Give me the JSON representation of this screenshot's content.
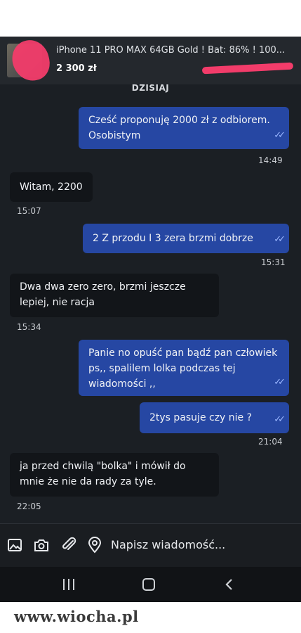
{
  "listing": {
    "title": "iPhone 11 PRO MAX 64GB Gold ! Bat: 86% ! 100...",
    "price": "2 300 zł"
  },
  "chat": {
    "date_separator": "DZISIAJ",
    "messages": [
      {
        "direction": "out",
        "text": "Cześć proponuję 2000 zł z odbiorem. Osobistym",
        "time": "14:49",
        "read": true
      },
      {
        "direction": "in",
        "text": "Witam, 2200",
        "time": "15:07"
      },
      {
        "direction": "out",
        "text": "2 Z przodu I 3 zera brzmi dobrze",
        "time": "15:31",
        "read": true
      },
      {
        "direction": "in",
        "text": "Dwa dwa zero zero, brzmi jeszcze lepiej, nie racja",
        "time": "15:34"
      },
      {
        "direction": "out",
        "text": "Panie no opuść pan bądź pan człowiek  ps,, spalilem  lolka podczas tej  wiadomości  ,,",
        "read": true
      },
      {
        "direction": "out",
        "text": "2tys pasuje  czy nie ?",
        "time": "21:04",
        "read": true
      },
      {
        "direction": "in",
        "text": "ja przed chwilą \"bolka\" i mówił do mnie że nie da rady za tyle.",
        "time": "22:05"
      }
    ]
  },
  "composer": {
    "placeholder": "Napisz wiadomość...",
    "icons": [
      "image-icon",
      "camera-icon",
      "attach-icon",
      "location-icon"
    ]
  },
  "watermark": "www.wiocha.pl",
  "colors": {
    "outgoing_bubble": "#2647a3",
    "incoming_bubble": "#121519",
    "background": "#1b1f24",
    "read_tick": "#9ab6ff",
    "redaction": "#f23c6a"
  }
}
